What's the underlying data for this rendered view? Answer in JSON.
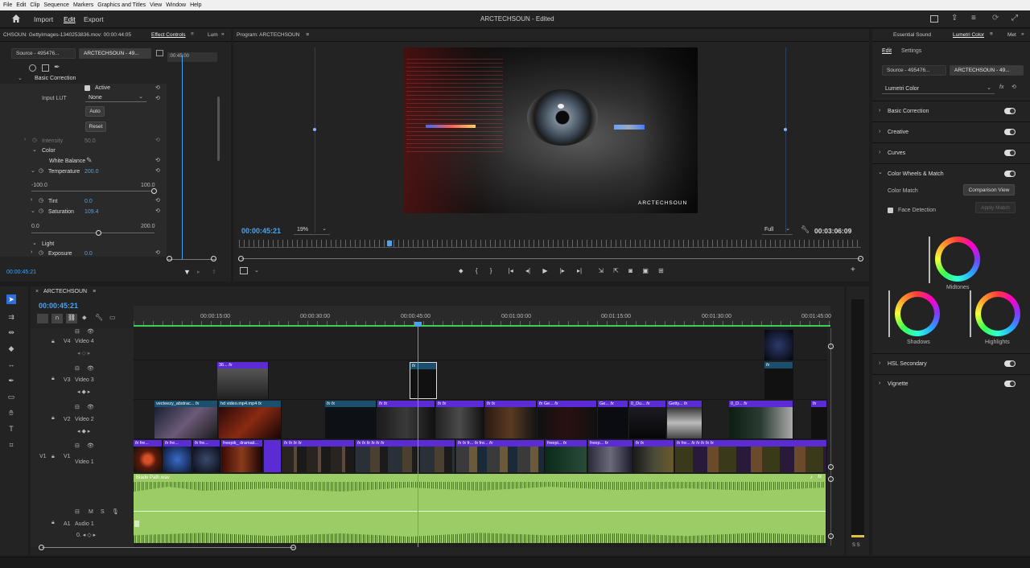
{
  "menu": [
    "File",
    "Edit",
    "Clip",
    "Sequence",
    "Markers",
    "Graphics and Titles",
    "View",
    "Window",
    "Help"
  ],
  "topnav": {
    "import": "Import",
    "edit": "Edit",
    "export": "Export",
    "project_title": "ARCTECHSOUN - Edited"
  },
  "effect_controls": {
    "source_path": "CHSOUN: GettyImages-1340253836.mov: 00:00:44:05",
    "tab_label": "Effect Controls",
    "tab_more": "Lum",
    "source_tab": "Source - 495476...",
    "seq_tab": "ARCTECHSOUN - 49...",
    "ruler_time": ":00:45:00",
    "section": "Basic Correction",
    "active_label": "Active",
    "input_lut_label": "Input LUT",
    "input_lut_value": "None",
    "auto_btn": "Auto",
    "reset_btn": "Reset",
    "intensity_label": "Intensity",
    "intensity_value": "50.0",
    "color_label": "Color",
    "white_balance": "White Balance",
    "temperature_label": "Temperature",
    "temperature_value": "200.0",
    "temp_min": "-100.0",
    "temp_max": "100.0",
    "temperature_position": 1.0,
    "tint_label": "Tint",
    "tint_value": "0.0",
    "saturation_label": "Saturation",
    "saturation_value": "109.4",
    "sat_min": "0.0",
    "sat_max": "200.0",
    "saturation_position": 0.547,
    "light_label": "Light",
    "exposure_label": "Exposure",
    "exposure_value": "0.0",
    "timecode": "00:00:45:21"
  },
  "program": {
    "title": "Program: ARCTECHSOUN",
    "timecode": "00:00:45:21",
    "zoom": "19%",
    "quality": "Full",
    "duration": "00:03:06:09",
    "watermark": "ARCTECHSOUN"
  },
  "lumetri": {
    "tab_essential": "Essential Sound",
    "tab_lumetri": "Lumetri Color",
    "tab_more": "Met",
    "sub_edit": "Edit",
    "sub_settings": "Settings",
    "source_tab": "Source - 495476...",
    "seq_tab": "ARCTECHSOUN - 49...",
    "effect_select": "Lumetri Color",
    "sections": [
      "Basic Correction",
      "Creative",
      "Curves",
      "Color Wheels & Match"
    ],
    "color_match": "Color Match",
    "comparison_view": "Comparison View",
    "face_detection": "Face Detection",
    "apply_match": "Apply Match",
    "wheel_midtones": "Midtones",
    "wheel_shadows": "Shadows",
    "wheel_highlights": "Highlights",
    "sections_bottom": [
      "HSL Secondary",
      "Vignette"
    ]
  },
  "timeline": {
    "sequence": "ARCTECHSOUN",
    "timecode": "00:00:45:21",
    "ruler": [
      "00:00:15:00",
      "00:00:30:00",
      "00:00:45:00",
      "00:01:00:00",
      "00:01:15:00",
      "00:01:30:00",
      "00:01:45:00"
    ],
    "tracks": {
      "v4": "V4",
      "v4_name": "Video 4",
      "v3": "V3",
      "v3_name": "Video 3",
      "v2": "V2",
      "v2_name": "Video 2",
      "v1": "V1",
      "v1_name": "Video 1",
      "a1": "A1",
      "a1_name": "Audio 1"
    },
    "v2_clips": [
      "vecteezy_abstrac...",
      "hd video.mp4.mp4",
      "Ge...",
      "Ge...",
      "0_Du...",
      "Getty...",
      "0_D..."
    ],
    "v1_clips": [
      "fre...",
      "fre...",
      "freepik_ dramati...",
      "fr...",
      "fre...",
      "freepi...",
      "freep...",
      "fre..."
    ],
    "v3_clip": "36...",
    "audio_clip": "Blade Path.wav",
    "meter_label": "S S"
  },
  "colors": {
    "accent": "#4aa3f0",
    "clip_purple": "#5b2bd4",
    "audio_green": "#9ccc65",
    "playhead": "#4aa3f0"
  }
}
